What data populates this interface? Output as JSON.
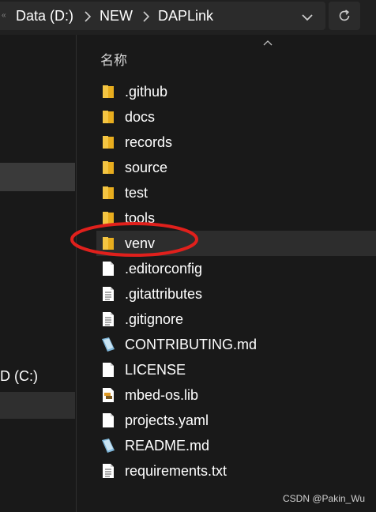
{
  "address_bar": {
    "overflow_glyph": "«",
    "breadcrumbs": [
      "Data (D:)",
      "NEW",
      "DAPLink"
    ],
    "separator_icon": "chevron-right-icon",
    "dropdown_icon": "chevron-down-icon",
    "refresh_icon": "refresh-icon"
  },
  "nav_pane": {
    "drive_label": "D (C:)"
  },
  "file_list": {
    "column_header": "名称",
    "sort_icon": "caret-up-icon",
    "items": [
      {
        "name": ".github",
        "icon": "folder-icon"
      },
      {
        "name": "docs",
        "icon": "folder-icon"
      },
      {
        "name": "records",
        "icon": "folder-icon"
      },
      {
        "name": "source",
        "icon": "folder-icon"
      },
      {
        "name": "test",
        "icon": "folder-icon"
      },
      {
        "name": "tools",
        "icon": "folder-icon"
      },
      {
        "name": "venv",
        "icon": "folder-icon"
      },
      {
        "name": ".editorconfig",
        "icon": "file-icon"
      },
      {
        "name": ".gitattributes",
        "icon": "text-file-icon"
      },
      {
        "name": ".gitignore",
        "icon": "text-file-icon"
      },
      {
        "name": "CONTRIBUTING.md",
        "icon": "markdown-file-icon"
      },
      {
        "name": "LICENSE",
        "icon": "file-icon"
      },
      {
        "name": "mbed-os.lib",
        "icon": "library-file-icon"
      },
      {
        "name": "projects.yaml",
        "icon": "file-icon"
      },
      {
        "name": "README.md",
        "icon": "markdown-file-icon"
      },
      {
        "name": "requirements.txt",
        "icon": "text-file-icon"
      }
    ],
    "hovered_item": "venv",
    "annotation_color": "#e0201c"
  },
  "watermark": "CSDN @Pakin_Wu",
  "colors": {
    "folder": "#f4c542",
    "window_bg": "#191919",
    "hover_bg": "#2d2d2d"
  }
}
